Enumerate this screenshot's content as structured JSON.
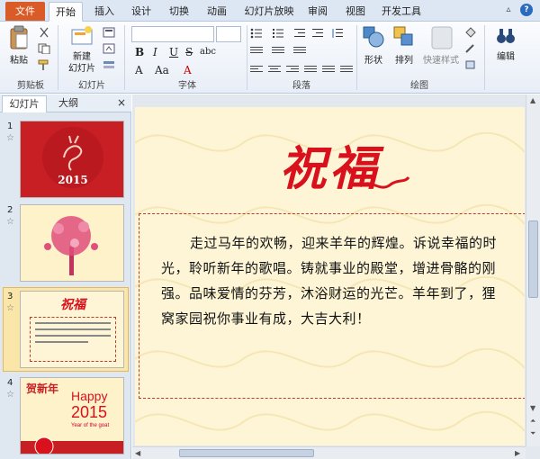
{
  "tabs": {
    "file": "文件",
    "items": [
      "开始",
      "插入",
      "设计",
      "切换",
      "动画",
      "幻灯片放映",
      "审阅",
      "视图",
      "开发工具"
    ],
    "active": "开始"
  },
  "ribbon": {
    "clipboard": {
      "paste": "粘贴",
      "label": "剪贴板"
    },
    "slides": {
      "new_slide_line1": "新建",
      "new_slide_line2": "幻灯片",
      "label": "幻灯片"
    },
    "font": {
      "label": "字体",
      "bold": "B",
      "italic": "I",
      "underline": "U",
      "strike": "S",
      "abc": "abc",
      "grow": "A",
      "aa": "Aa"
    },
    "paragraph": {
      "label": "段落"
    },
    "drawing": {
      "shape": "形状",
      "arrange": "排列",
      "quick_styles": "快速样式",
      "label": "绘图"
    },
    "editing": {
      "label": "编辑"
    }
  },
  "pane": {
    "tab_slides": "幻灯片",
    "tab_outline": "大纲",
    "close": "×",
    "slides": [
      {
        "num": "1",
        "star": "☆",
        "text": "2015"
      },
      {
        "num": "2",
        "star": "☆"
      },
      {
        "num": "3",
        "star": "☆",
        "title": "祝福"
      },
      {
        "num": "4",
        "star": "☆",
        "title": "贺新年",
        "happy": "Happy",
        "year": "2015",
        "sub": "Year of the goat"
      }
    ],
    "selected_index": 3
  },
  "slide": {
    "title": "祝福",
    "paragraph": "走过马年的欢畅，迎来羊年的辉煌。诉说幸福的时光，聆听新年的歌唱。铸就事业的殿堂，增进骨骼的刚强。品味爱情的芬芳，沐浴财运的光芒。羊年到了，狸窝家园祝你事业有成，大吉大利！"
  },
  "colors": {
    "accent": "#d95b27",
    "slide_bg": "#fdf5d6",
    "title_red": "#d8111c"
  }
}
